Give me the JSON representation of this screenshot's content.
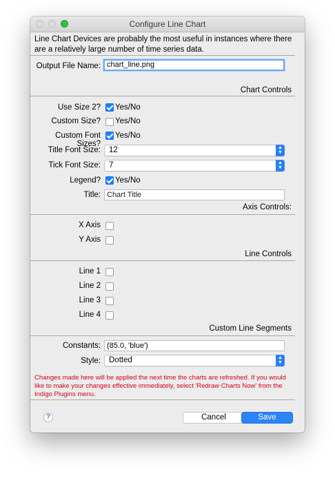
{
  "window": {
    "title": "Configure Line Chart"
  },
  "description": "Line Chart Devices are probably the most useful in instances where there are a relatively large number of time series data.",
  "output": {
    "label": "Output File Name:",
    "value": "chart_line.png"
  },
  "sections": {
    "chart_controls": "Chart Controls",
    "axis_controls": "Axis Controls:",
    "line_controls": "Line Controls",
    "custom_line_segments": "Custom Line Segments"
  },
  "chart_controls": {
    "use_size_2": {
      "label": "Use Size 2?",
      "checked": true,
      "text": "Yes/No"
    },
    "custom_size": {
      "label": "Custom Size?",
      "checked": false,
      "text": "Yes/No"
    },
    "custom_font_sizes": {
      "label": "Custom Font Sizes?",
      "checked": true,
      "text": "Yes/No"
    },
    "title_font_size": {
      "label": "Title Font Size:",
      "value": "12"
    },
    "tick_font_size": {
      "label": "Tick Font Size:",
      "value": "7"
    },
    "legend": {
      "label": "Legend?",
      "checked": true,
      "text": "Yes/No"
    },
    "title": {
      "label": "Title:",
      "placeholder": "Chart Title"
    }
  },
  "axis_controls": {
    "x_axis": {
      "label": "X Axis",
      "checked": false
    },
    "y_axis": {
      "label": "Y Axis",
      "checked": false
    }
  },
  "line_controls": {
    "line1": {
      "label": "Line 1",
      "checked": false
    },
    "line2": {
      "label": "Line 2",
      "checked": false
    },
    "line3": {
      "label": "Line 3",
      "checked": false
    },
    "line4": {
      "label": "Line 4",
      "checked": false
    }
  },
  "custom_line_segments": {
    "constants": {
      "label": "Constants:",
      "value": "(85.0, 'blue')"
    },
    "style": {
      "label": "Style:",
      "value": "Dotted"
    }
  },
  "warning": "Changes made here will be applied the next time the charts are refreshed. If you would like to make your changes effective immediately, select 'Redraw Charts Now' from the Indigo Plugins menu.",
  "buttons": {
    "help": "?",
    "cancel": "Cancel",
    "save": "Save"
  },
  "colors": {
    "accent": "#2b85f7",
    "warning": "#d0021b",
    "window_bg": "#ececec"
  }
}
